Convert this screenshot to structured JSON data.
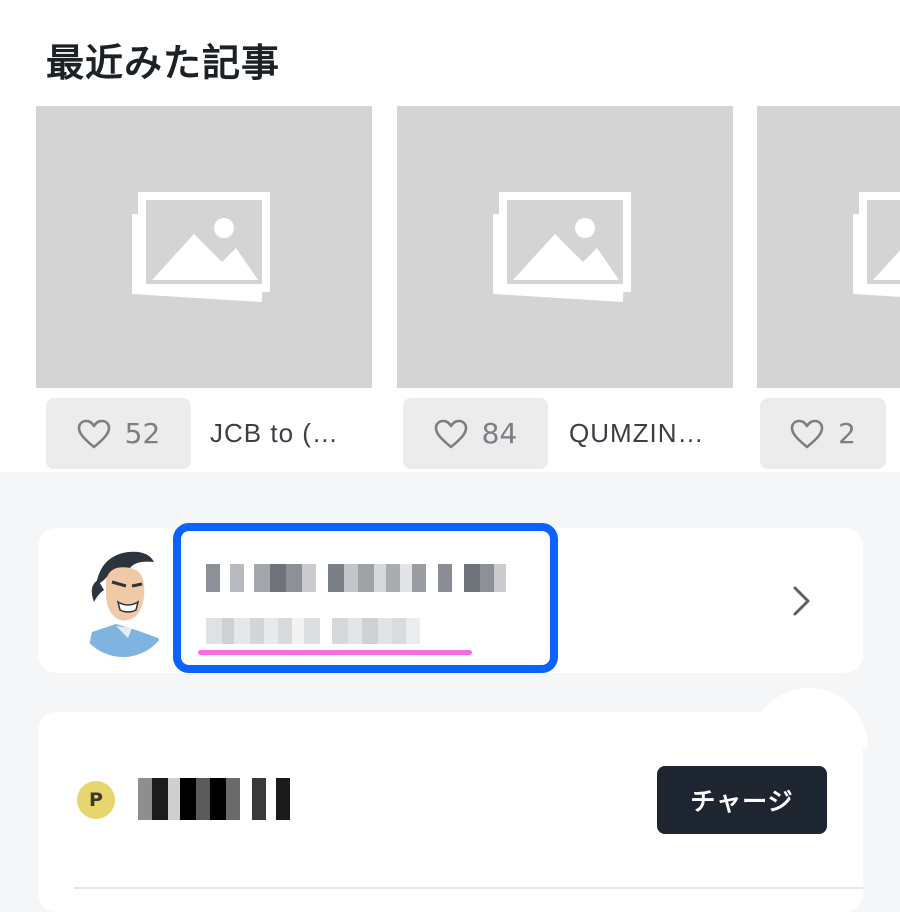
{
  "recent": {
    "title": "最近みた記事",
    "cards": [
      {
        "likes": "52",
        "title": "JCB to (…"
      },
      {
        "likes": "84",
        "title": "QUMZIN…"
      },
      {
        "likes": "2",
        "title": ""
      }
    ]
  },
  "profile": {
    "avatar_icon": "user-avatar",
    "chevron_icon": "chevron-right-icon",
    "highlight_color": "#0a63ff",
    "underline_color": "#f76be6"
  },
  "points": {
    "icon_label": "P",
    "charge_label": "チャージ",
    "accent_color": "#e7d56d"
  }
}
